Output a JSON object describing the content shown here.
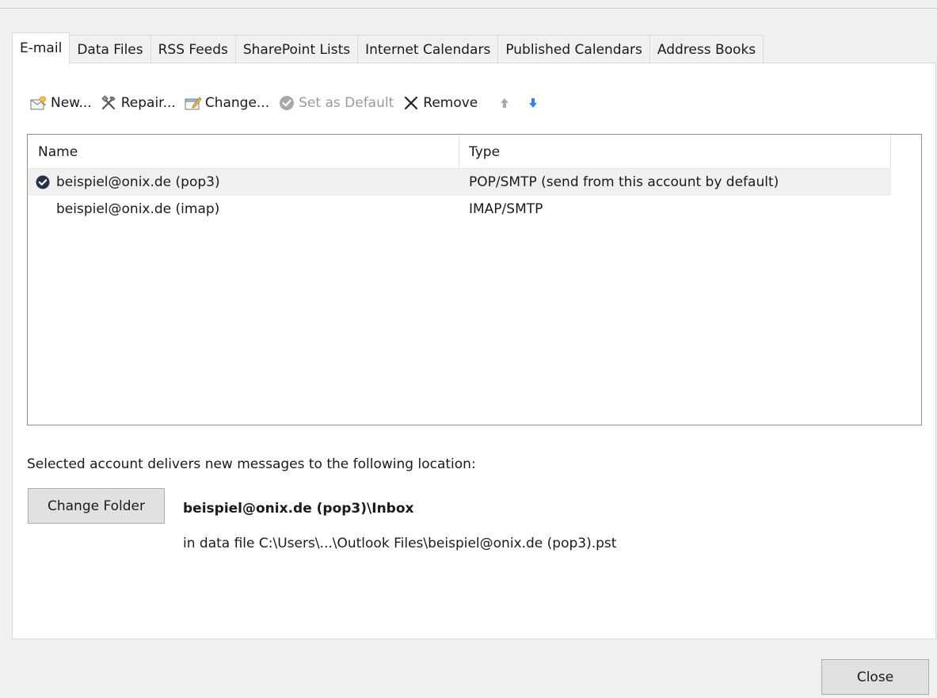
{
  "tabs": [
    {
      "label": "E-mail",
      "active": true
    },
    {
      "label": "Data Files"
    },
    {
      "label": "RSS Feeds"
    },
    {
      "label": "SharePoint Lists"
    },
    {
      "label": "Internet Calendars"
    },
    {
      "label": "Published Calendars"
    },
    {
      "label": "Address Books"
    }
  ],
  "toolbar": {
    "new_label": "New...",
    "repair_label": "Repair...",
    "change_label": "Change...",
    "set_default_label": "Set as Default",
    "remove_label": "Remove",
    "icons": {
      "new": "new-account-icon",
      "repair": "repair-tools-icon",
      "change": "change-account-icon",
      "set_default": "check-circle-icon",
      "remove": "remove-x-icon",
      "move_up": "arrow-up-icon",
      "move_down": "arrow-down-icon"
    }
  },
  "list": {
    "columns": {
      "name": "Name",
      "type": "Type"
    },
    "rows": [
      {
        "name": "beispiel@onix.de (pop3)",
        "type": "POP/SMTP (send from this account by default)",
        "default": true,
        "selected": true
      },
      {
        "name": "beispiel@onix.de (imap)",
        "type": "IMAP/SMTP",
        "default": false,
        "selected": false
      }
    ]
  },
  "location": {
    "label": "Selected account delivers new messages to the following location:",
    "change_folder_label": "Change Folder",
    "folder_path": "beispiel@onix.de (pop3)\\Inbox",
    "data_file": "in data file C:\\Users\\...\\Outlook Files\\beispiel@onix.de (pop3).pst"
  },
  "footer": {
    "close_label": "Close"
  },
  "colors": {
    "background": "#f0f0f0",
    "panel": "#ffffff",
    "selected_row": "#f0f0f0",
    "arrow_blue": "#3c7ee8",
    "disabled_text": "#9a9a9a"
  }
}
